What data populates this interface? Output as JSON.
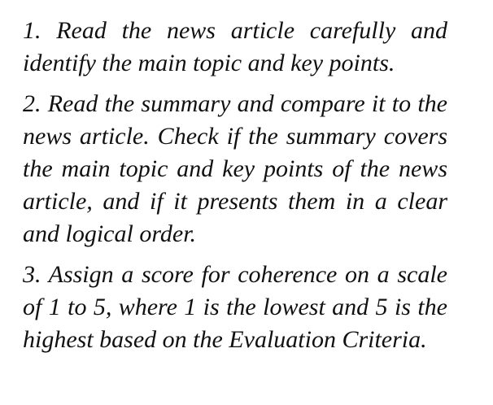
{
  "steps": [
    {
      "text": "1.  Read the news article carefully and identify the main topic and key points."
    },
    {
      "text": "2. Read the summary and compare it to the news article. Check if the summary covers the main topic and key points of the news article, and if it presents them in a clear and logical order."
    },
    {
      "text": "3.  Assign a score for coherence on a scale of 1 to 5, where 1 is the lowest and 5 is the highest based on the Evaluation Criteria."
    }
  ]
}
